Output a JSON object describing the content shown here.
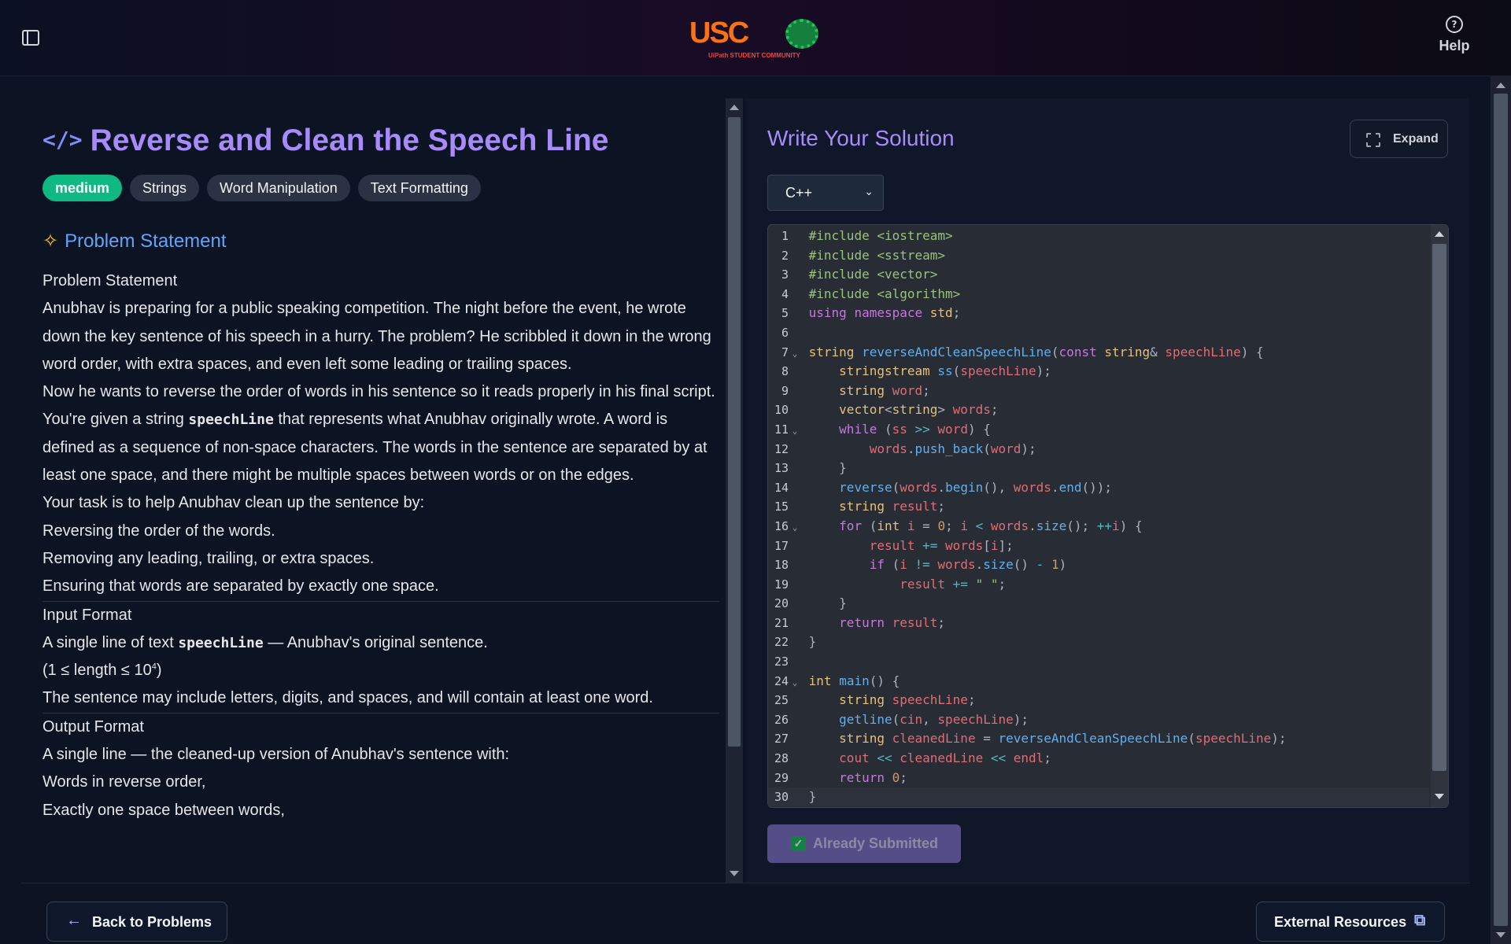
{
  "header": {
    "logo_text": "USC",
    "logo_subtitle": "UiPath STUDENT COMMUNITY",
    "help_label": "Help",
    "icons": [
      "sidebar-toggle-icon",
      "help-circle-icon"
    ]
  },
  "problem": {
    "title": "Reverse and Clean the Speech Line",
    "tags": [
      "medium",
      "Strings",
      "Word Manipulation",
      "Text Formatting"
    ],
    "section_title": "Problem Statement",
    "lines": {
      "l1": "Problem Statement",
      "l2": "Anubhav is preparing for a public speaking competition. The night before the event, he wrote down the key sentence of his speech in a hurry. The problem? He scribbled it down in the wrong word order, with extra spaces, and even left some leading or trailing spaces.",
      "l3": "Now he wants to reverse the order of words in his sentence so it reads properly in his final script.",
      "l4a": "You're given a string ",
      "l4code": "speechLine",
      "l4b": " that represents what Anubhav originally wrote. A word is defined as a sequence of non-space characters. The words in the sentence are separated by at least one space, and there might be multiple spaces between words or on the edges.",
      "l5": "Your task is to help Anubhav clean up the sentence by:",
      "l6": "Reversing the order of the words.",
      "l7": "Removing any leading, trailing, or extra spaces.",
      "l8": "Ensuring that words are separated by exactly one space.",
      "l9": "Input Format",
      "l10a": "A single line of text ",
      "l10code": "speechLine",
      "l10b": " — Anubhav's original sentence.",
      "l11a": "(1 ≤ length ≤ 10",
      "l11sup": "4",
      "l11b": ")",
      "l12": "The sentence may include letters, digits, and spaces, and will contain at least one word.",
      "l13": "Output Format",
      "l14": "A single line — the cleaned-up version of Anubhav's sentence with:",
      "l15": "Words in reverse order,",
      "l16": "Exactly one space between words,"
    }
  },
  "solution": {
    "title": "Write Your Solution",
    "expand_label": "Expand",
    "language": "C++",
    "submitted_label": "Already Submitted"
  },
  "footer": {
    "back_label": "Back to Problems",
    "external_label": "External Resources"
  },
  "colors": {
    "accent": "#a78bfa",
    "difficulty_medium": "#10b981",
    "section_blue": "#60a5fa"
  }
}
